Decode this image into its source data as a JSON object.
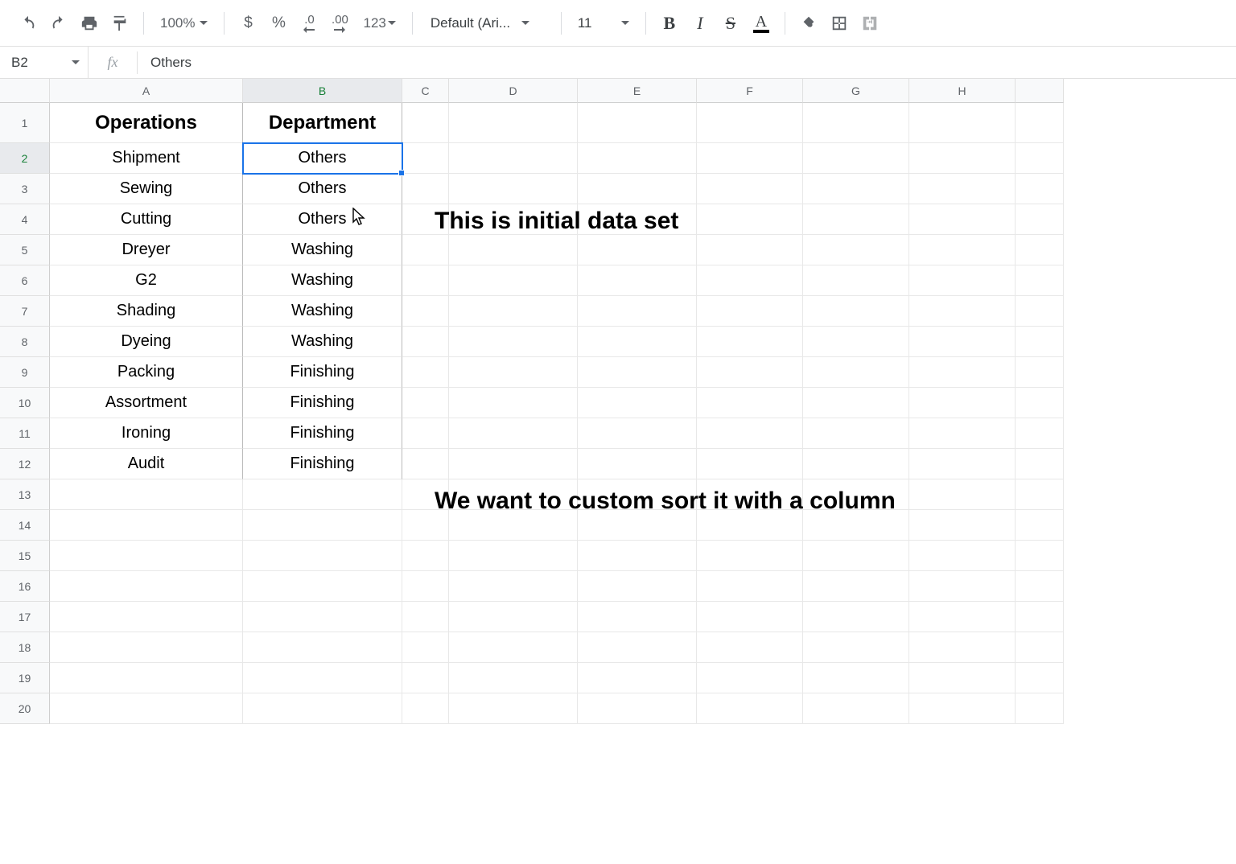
{
  "toolbar": {
    "zoom": "100%",
    "currency": "$",
    "percent": "%",
    "dec_less": ".0",
    "dec_more": ".00",
    "format": "123",
    "font": "Default (Ari...",
    "font_size": "11",
    "bold": "B",
    "italic": "I",
    "strike": "S",
    "text_color": "A"
  },
  "formula_bar": {
    "cell_ref": "B2",
    "fx": "fx",
    "value": "Others"
  },
  "columns": [
    "A",
    "B",
    "C",
    "D",
    "E",
    "F",
    "G",
    "H"
  ],
  "row_numbers": [
    "1",
    "2",
    "3",
    "4",
    "5",
    "6",
    "7",
    "8",
    "9",
    "10",
    "11",
    "12",
    "13",
    "14",
    "15",
    "16",
    "17",
    "18",
    "19",
    "20"
  ],
  "headers": {
    "A": "Operations",
    "B": "Department"
  },
  "data": [
    {
      "A": "Shipment",
      "B": "Others"
    },
    {
      "A": "Sewing",
      "B": "Others"
    },
    {
      "A": "Cutting",
      "B": "Others"
    },
    {
      "A": "Dreyer",
      "B": "Washing"
    },
    {
      "A": "G2",
      "B": "Washing"
    },
    {
      "A": "Shading",
      "B": "Washing"
    },
    {
      "A": "Dyeing",
      "B": "Washing"
    },
    {
      "A": "Packing",
      "B": "Finishing"
    },
    {
      "A": "Assortment",
      "B": "Finishing"
    },
    {
      "A": "Ironing",
      "B": "Finishing"
    },
    {
      "A": "Audit",
      "B": "Finishing"
    }
  ],
  "selected_cell": "B2",
  "annotations": {
    "a1": "This is initial data set",
    "a2": "We want to custom sort it with a column"
  }
}
